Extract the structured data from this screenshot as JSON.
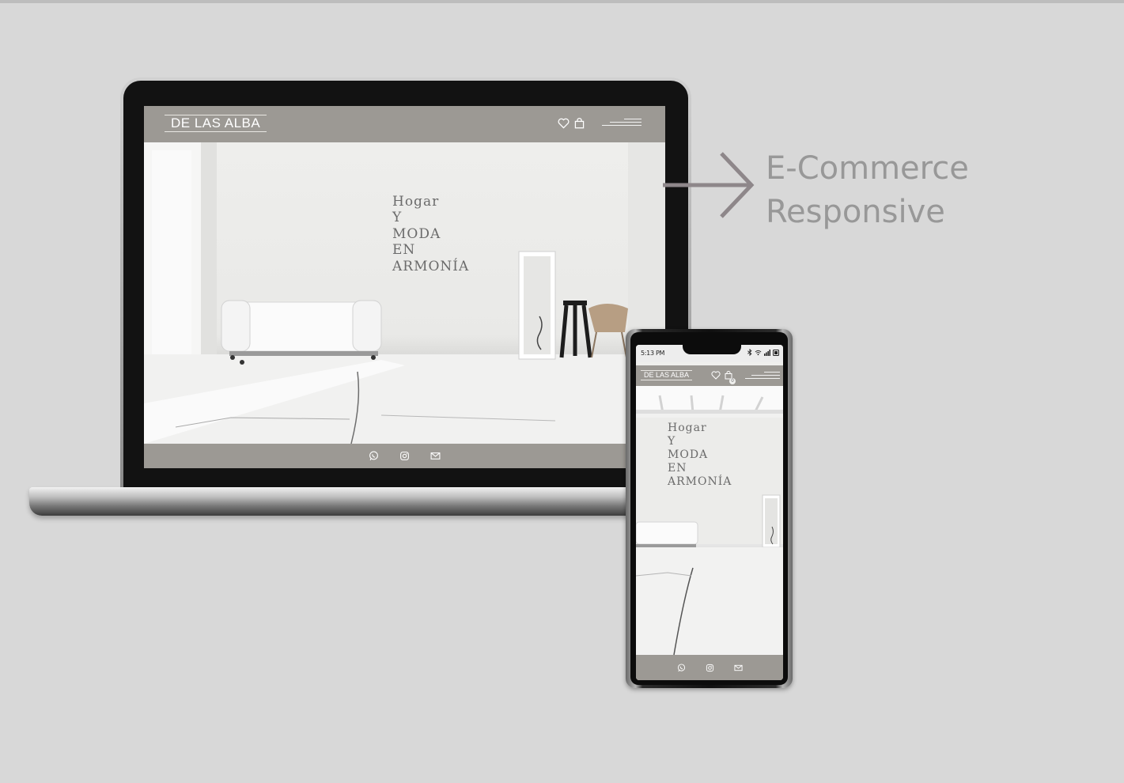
{
  "tagline": {
    "line1": "E-Commerce",
    "line2": "Responsive"
  },
  "site": {
    "logo": "DE LAS ALBA",
    "hero_lines": [
      "Hogar",
      "Y",
      "MODA",
      "EN",
      "ARMONÍA"
    ]
  },
  "phone": {
    "time": "5:13 PM",
    "cart_count": "0"
  },
  "icons": {
    "wishlist": "heart-icon",
    "cart": "shopping-bag-icon",
    "menu": "hamburger-menu-icon",
    "whatsapp": "whatsapp-icon",
    "instagram": "instagram-icon",
    "email": "mail-icon"
  },
  "colors": {
    "background": "#d8d8d8",
    "header_bar": "#9c9994",
    "tagline_text": "#989898",
    "arrow": "#8e878a"
  }
}
